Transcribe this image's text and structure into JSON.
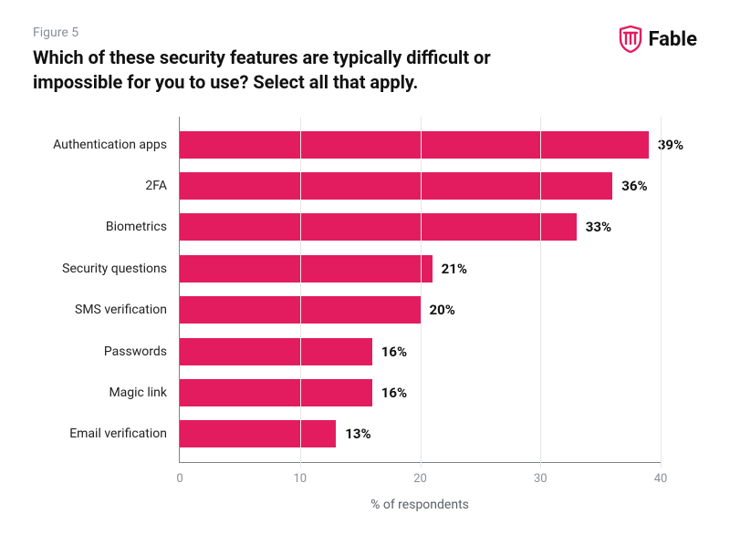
{
  "figure_label": "Figure 5",
  "title": "Which of these security features are typically difficult or impossible for you to use? Select all that apply.",
  "brand": {
    "name": "Fable",
    "color": "#e31c5f"
  },
  "chart_data": {
    "type": "bar",
    "orientation": "horizontal",
    "categories": [
      "Authentication apps",
      "2FA",
      "Biometrics",
      "Security questions",
      "SMS verification",
      "Passwords",
      "Magic link",
      "Email verification"
    ],
    "values": [
      39,
      36,
      33,
      21,
      20,
      16,
      16,
      13
    ],
    "value_suffix": "%",
    "xlabel": "% of respondents",
    "ylabel": "",
    "xlim": [
      0,
      40
    ],
    "xticks": [
      0,
      10,
      20,
      30,
      40
    ],
    "bar_color": "#e31c5f"
  }
}
